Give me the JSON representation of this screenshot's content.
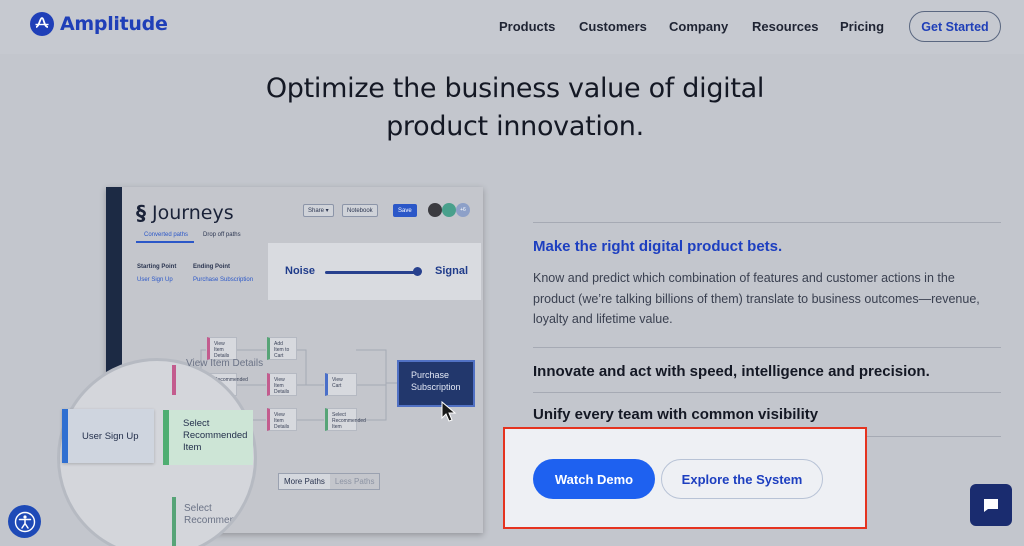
{
  "header": {
    "brand": "Amplitude",
    "nav": [
      "Products",
      "Customers",
      "Company",
      "Resources",
      "Pricing"
    ],
    "cta": "Get Started"
  },
  "hero": {
    "headline_line1": "Optimize the business value of digital",
    "headline_line2": "product innovation."
  },
  "content": {
    "subheading": "Make the right digital product bets.",
    "body": "Know and predict which combination of features and customer actions in the product (we’re talking billions of them) translate to business outcomes—revenue, loyalty and lifetime value.",
    "points": [
      "Innovate and act with speed, intelligence and precision.",
      "Unify every team with common visibility"
    ],
    "primary_button": "Watch Demo",
    "secondary_button": "Explore the System"
  },
  "product_shot": {
    "title": "Journeys",
    "toolbar": {
      "share": "Share ▾",
      "notebook": "Notebook",
      "save": "Save",
      "more": "+6"
    },
    "tabs": [
      "Converted paths",
      "Drop off paths"
    ],
    "starting_point_label": "Starting Point",
    "starting_point_value": "User Sign Up",
    "ending_point_label": "Ending Point",
    "ending_point_value": "Purchase Subscription",
    "noise_label": "Noise",
    "signal_label": "Signal",
    "slider_level": 0.95,
    "small_nodes": [
      "View Item Details",
      "Add Item to Cart",
      "Recommended",
      "View Item Details",
      "View Cart",
      "View Item Details",
      "Select Recommended Item"
    ],
    "purchase_node": "Purchase Subscription",
    "magnified_nodes": [
      "View Item Details",
      "Select Recommended"
    ],
    "user_signup": "User Sign Up",
    "select_recommended": "Select Recommended Item",
    "pager_more": "More Paths",
    "pager_less": "Less Paths"
  },
  "colors": {
    "brand": "#1f3fb8",
    "primary_button": "#1e61f0",
    "highlight_border": "#e5331f",
    "accent_text": "#1d3fc0"
  }
}
